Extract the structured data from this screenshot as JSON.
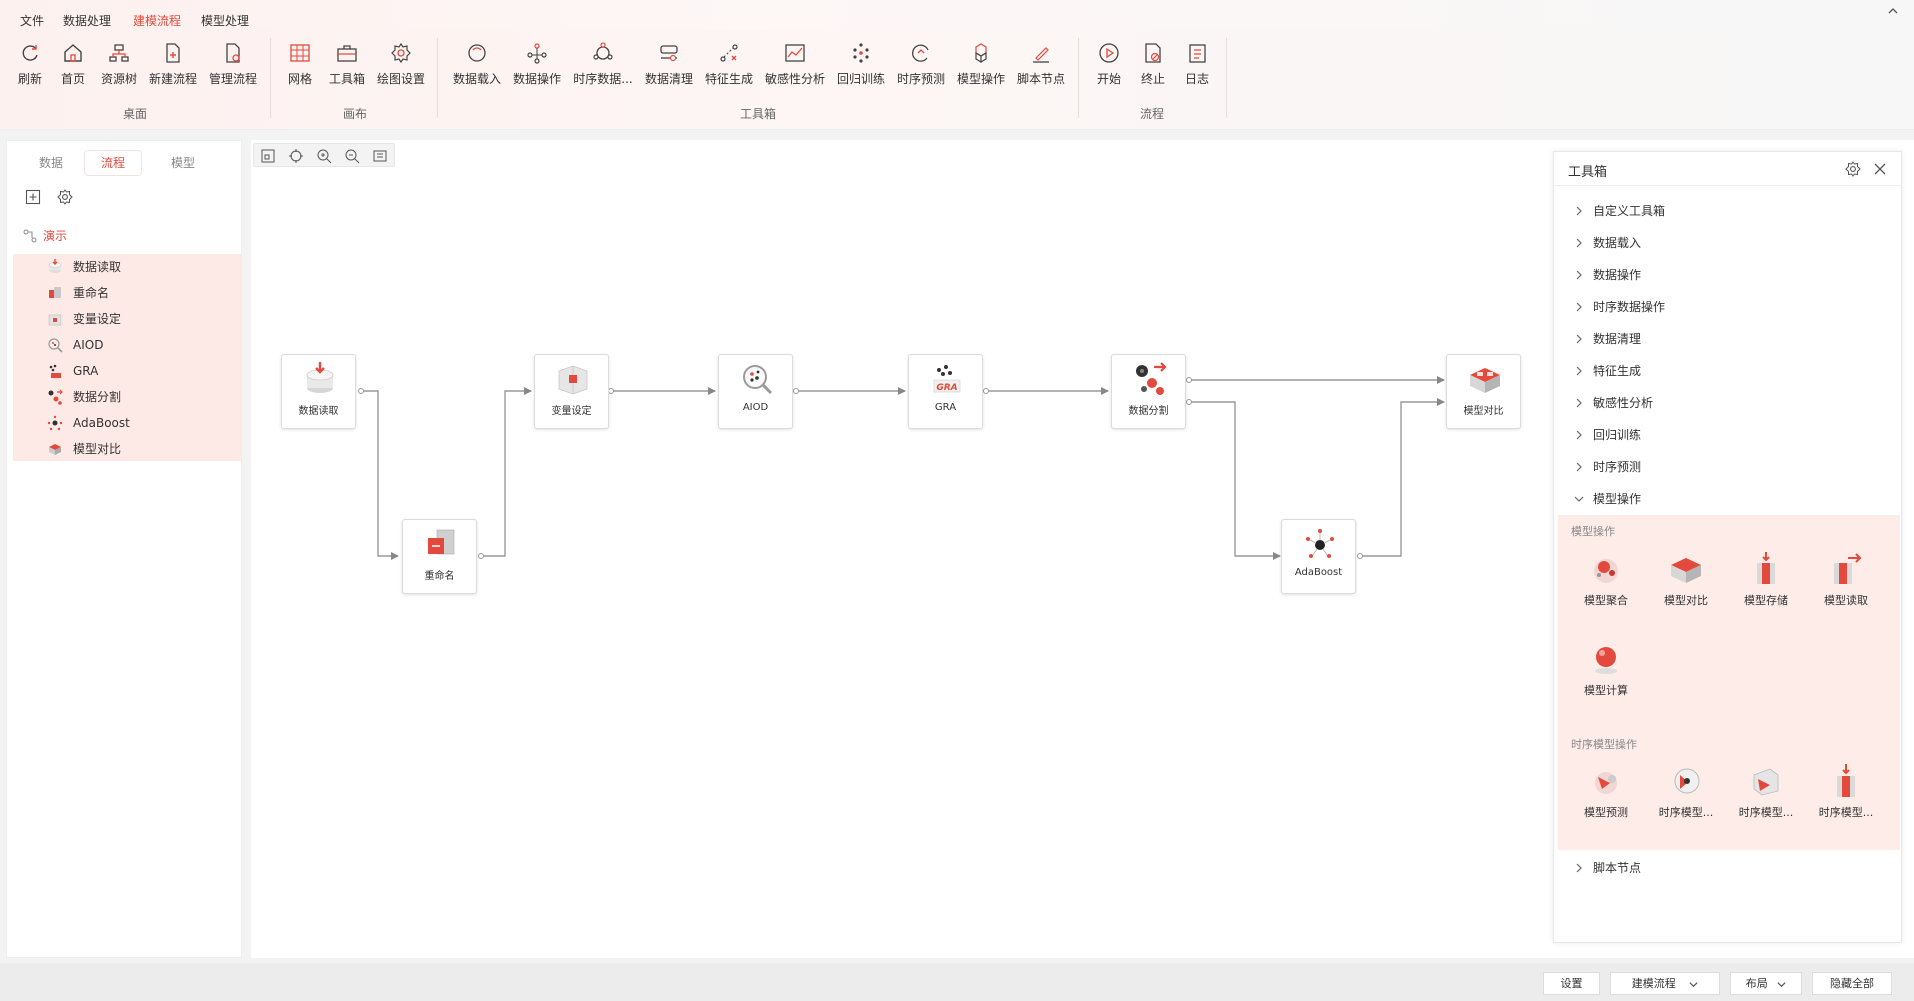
{
  "menu": {
    "items": [
      "文件",
      "数据处理",
      "建模流程",
      "模型处理"
    ],
    "active": "建模流程"
  },
  "ribbon": {
    "groups": {
      "desktop": "桌面",
      "canvas": "画布",
      "toolbox": "工具箱",
      "flow": "流程"
    },
    "buttons": {
      "refresh": "刷新",
      "home": "首页",
      "resource_tree": "资源树",
      "new_flow": "新建流程",
      "manage_flow": "管理流程",
      "grid": "网格",
      "toolbox": "工具箱",
      "draw_settings": "绘图设置",
      "data_load": "数据载入",
      "data_op": "数据操作",
      "ts_data": "时序数据...",
      "data_clean": "数据清理",
      "feature_gen": "特征生成",
      "sensitivity": "敏感性分析",
      "regression": "回归训练",
      "ts_predict": "时序预测",
      "model_op": "模型操作",
      "script_node": "脚本节点",
      "start": "开始",
      "stop": "终止",
      "log": "日志"
    }
  },
  "left_panel": {
    "tabs": [
      "数据",
      "流程",
      "模型"
    ],
    "active_tab": "流程",
    "root": "演示",
    "items": [
      "数据读取",
      "重命名",
      "变量设定",
      "AIOD",
      "GRA",
      "数据分割",
      "AdaBoost",
      "模型对比"
    ]
  },
  "flow_nodes": {
    "n1": "数据读取",
    "n2": "重命名",
    "n3": "变量设定",
    "n4": "AIOD",
    "n5": "GRA",
    "n6": "数据分割",
    "n7": "AdaBoost",
    "n8": "模型对比"
  },
  "toolbox": {
    "title": "工具箱",
    "categories": [
      "自定义工具箱",
      "数据载入",
      "数据操作",
      "时序数据操作",
      "数据清理",
      "特征生成",
      "敏感性分析",
      "回归训练",
      "时序预测",
      "模型操作"
    ],
    "expanded": {
      "section1": "模型操作",
      "tools1": [
        "模型聚合",
        "模型对比",
        "模型存储",
        "模型读取",
        "模型计算"
      ],
      "section2": "时序模型操作",
      "tools2": [
        "模型预测",
        "时序模型...",
        "时序模型...",
        "时序模型..."
      ]
    },
    "last_category": "脚本节点"
  },
  "status": {
    "settings": "设置",
    "flow": "建模流程",
    "layout": "布局",
    "hide_all": "隐藏全部"
  },
  "colors": {
    "accent": "#e34a3d",
    "highlight_bg": "#fdeae6"
  }
}
